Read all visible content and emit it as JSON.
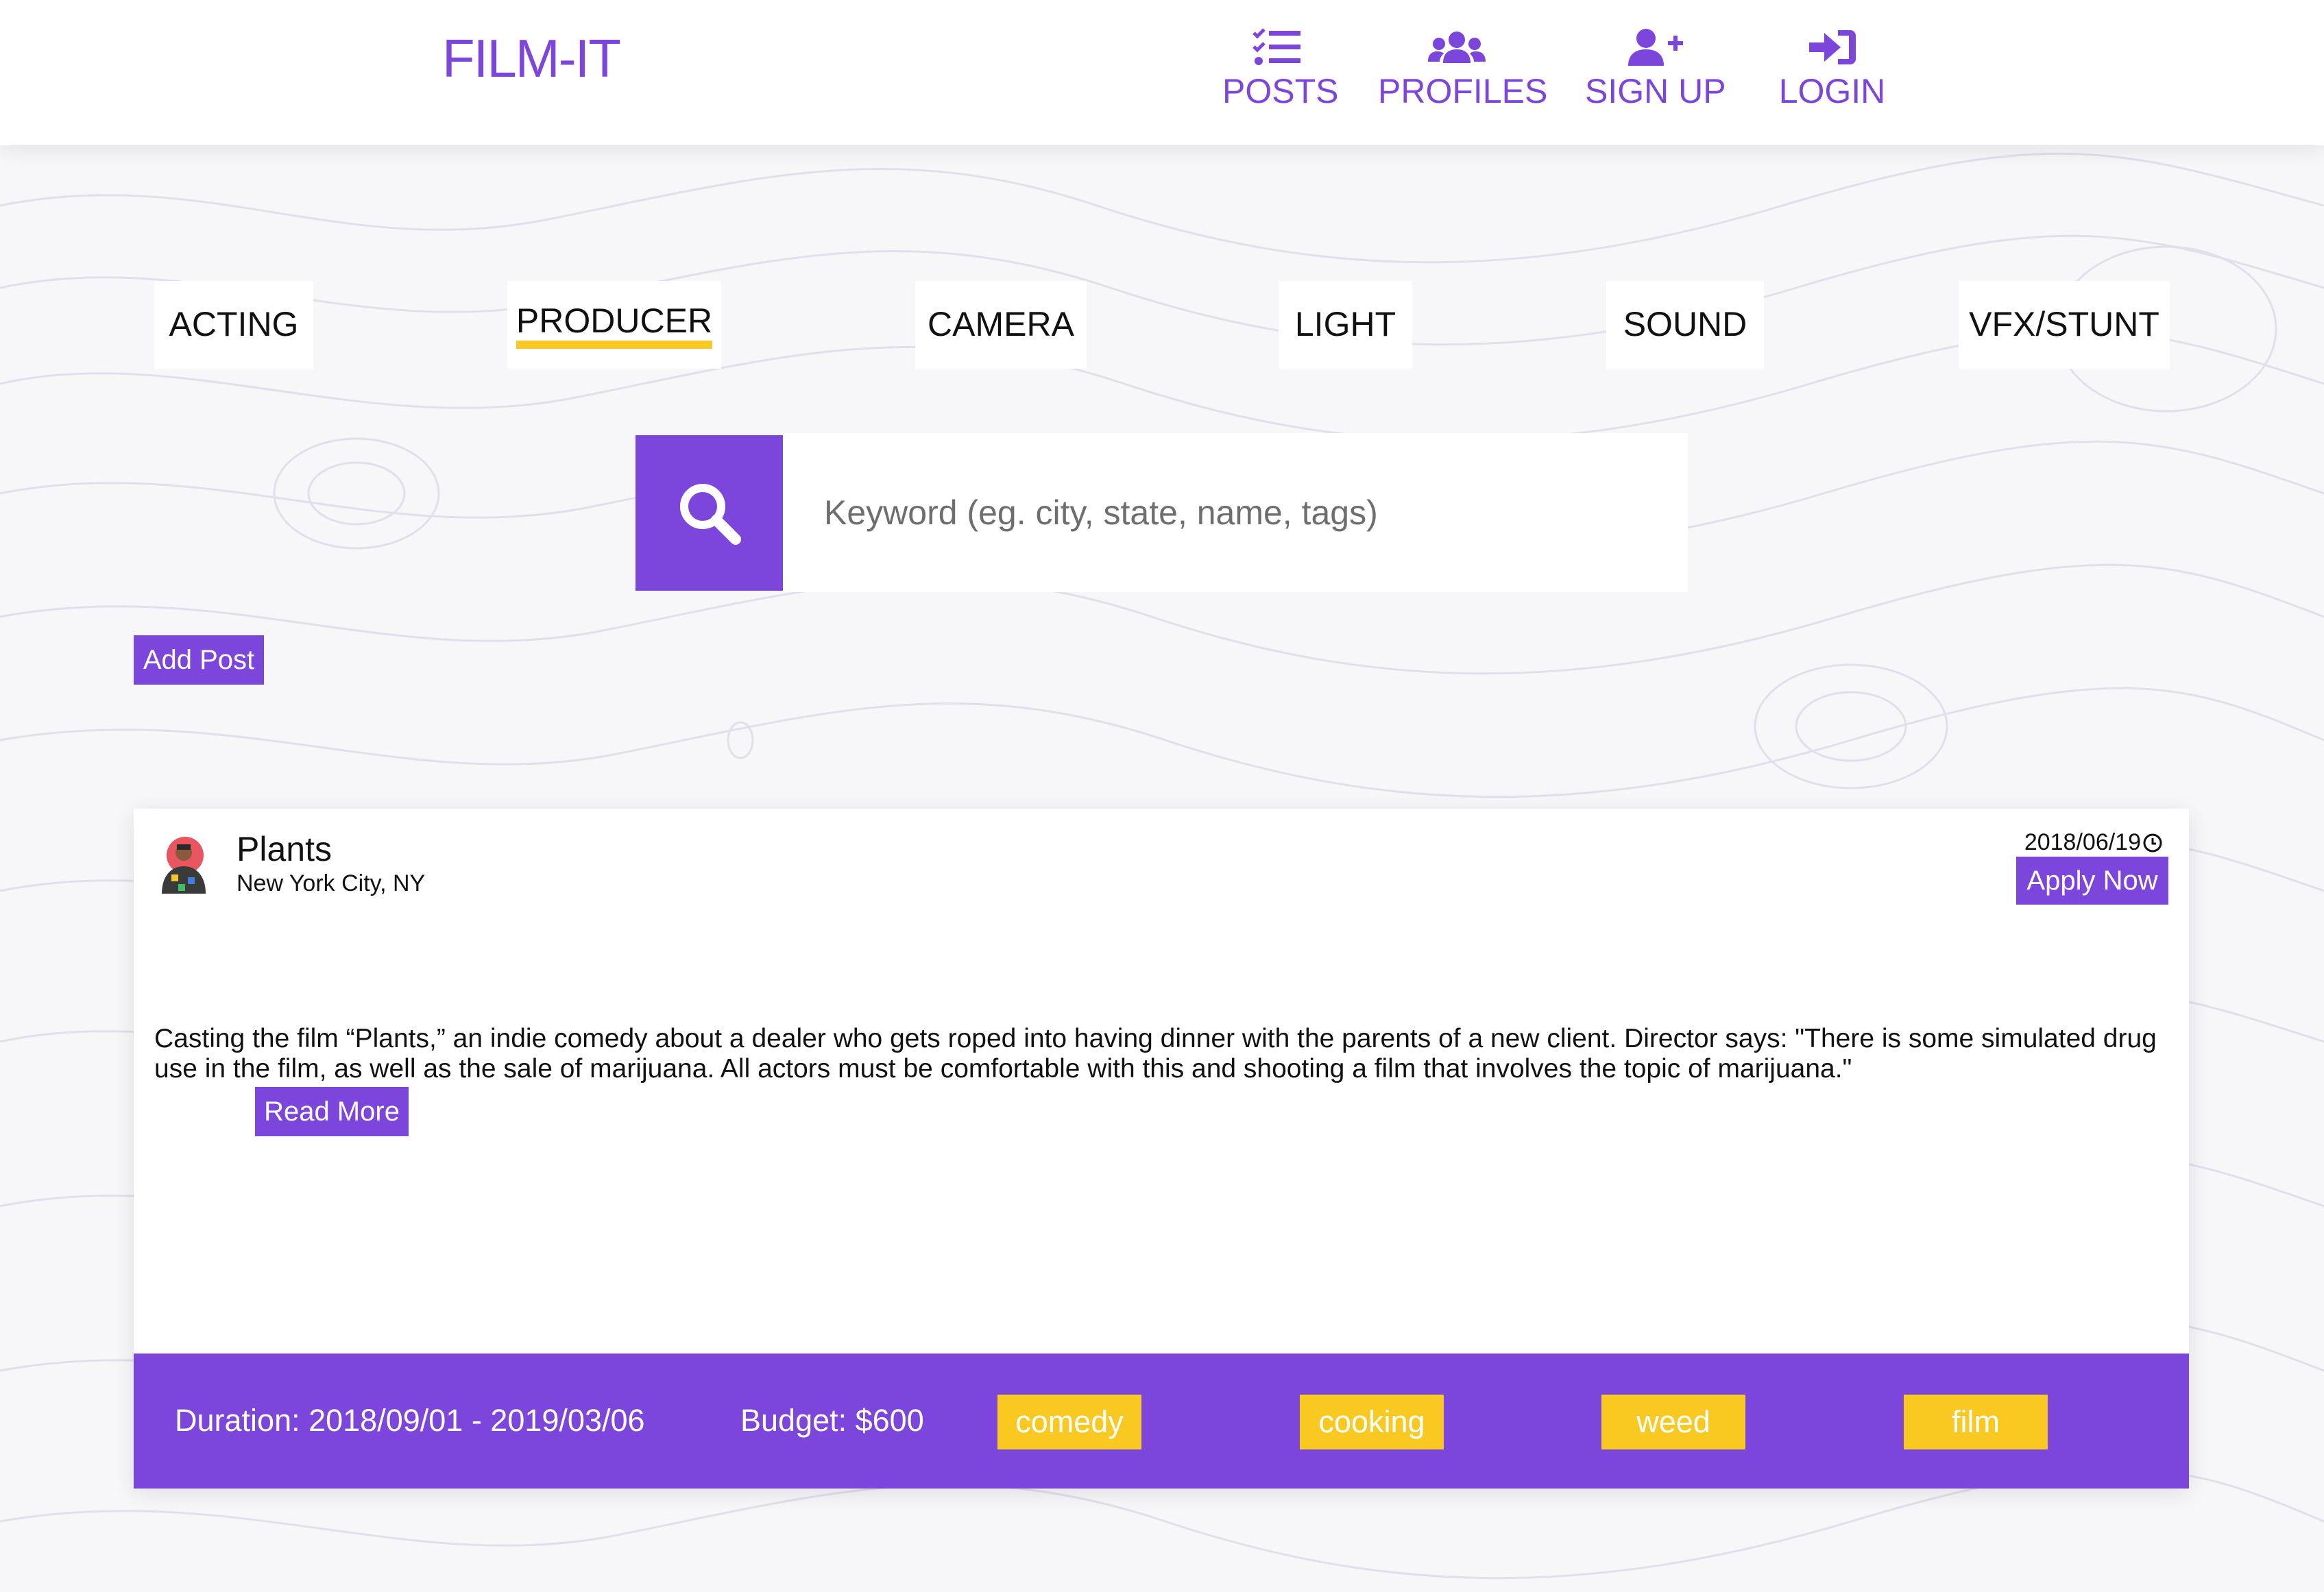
{
  "header": {
    "logo": "FILM-IT",
    "nav": [
      {
        "label": "POSTS",
        "icon": "tasks-list-icon"
      },
      {
        "label": "PROFILES",
        "icon": "users-icon"
      },
      {
        "label": "SIGN UP",
        "icon": "user-plus-icon"
      },
      {
        "label": "LOGIN",
        "icon": "sign-in-icon"
      }
    ]
  },
  "categories": [
    {
      "label": "ACTING"
    },
    {
      "label": "PRODUCER",
      "active": true
    },
    {
      "label": "CAMERA"
    },
    {
      "label": "LIGHT"
    },
    {
      "label": "SOUND"
    },
    {
      "label": "VFX/STUNT"
    }
  ],
  "search": {
    "placeholder": "Keyword (eg. city, state, name, tags)",
    "value": "",
    "icon": "search-icon"
  },
  "add_post_label": "Add Post",
  "post": {
    "title": "Plants",
    "location": "New York City, NY",
    "date": "2018/06/19",
    "apply_label": "Apply Now",
    "description": "Casting the film “Plants,” an indie comedy about a dealer who gets roped into having dinner with the parents of a new client. Director says: \"There is some simulated drug use in the film, as well as the sale of marijuana. All actors must be comfortable with this and shooting a film that involves the topic of marijuana.\"",
    "read_more_label": "Read More",
    "duration": "Duration: 2018/09/01 - 2019/03/06",
    "budget": "Budget: $600",
    "tags": [
      "comedy",
      "cooking",
      "weed",
      "film"
    ]
  },
  "colors": {
    "accent": "#7c46dd",
    "highlight": "#f9c921",
    "background": "#f7f6f9"
  }
}
